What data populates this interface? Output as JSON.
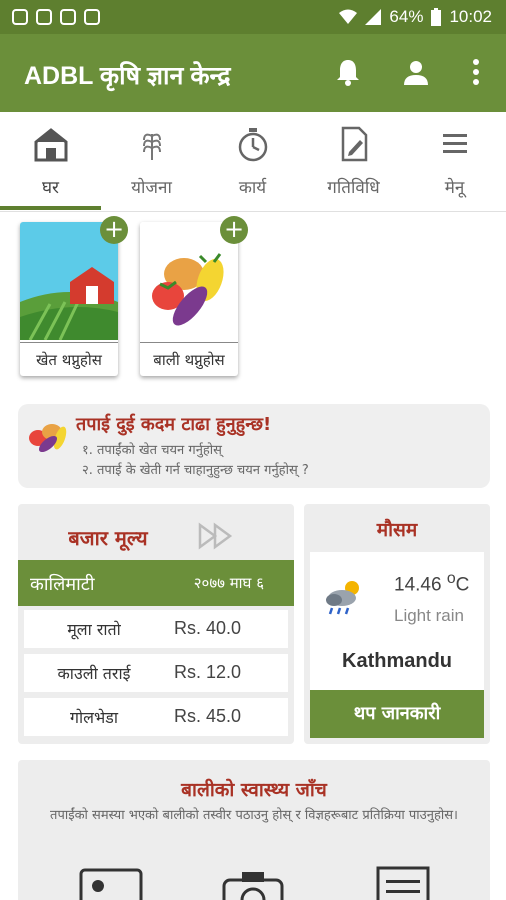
{
  "status_bar": {
    "battery": "64%",
    "time": "10:02"
  },
  "app_bar": {
    "title": "ADBL कृषि ज्ञान केन्द्र",
    "icons": [
      "bell-icon",
      "person-icon",
      "more-vert-icon"
    ]
  },
  "tabs": [
    {
      "label": "घर",
      "icon": "home-icon",
      "active": true
    },
    {
      "label": "योजना",
      "icon": "wheat-icon",
      "active": false
    },
    {
      "label": "कार्य",
      "icon": "stopwatch-icon",
      "active": false
    },
    {
      "label": "गतिविधि",
      "icon": "document-edit-icon",
      "active": false
    },
    {
      "label": "मेनू",
      "icon": "menu-icon",
      "active": false
    }
  ],
  "tiles": [
    {
      "label": "खेत थप्नुहोस",
      "icon": "farm-icon"
    },
    {
      "label": "बाली थप्नुहोस",
      "icon": "vegetables-icon"
    }
  ],
  "info_card": {
    "heading": "तपाई दुई कदम टाढा हुनुहुन्छ!",
    "line1": "१. तपाईंको खेत चयन गर्नुहोस्",
    "line2": "२. तपाई के खेती गर्न चाहानुहुन्छ चयन गर्नुहोस् ?"
  },
  "market": {
    "title": "बजार मूल्य",
    "place": "कालिमाटी",
    "date": "२०७७ माघ ६",
    "rows": [
      {
        "name": "मूला रातो",
        "price": "Rs. 40.0"
      },
      {
        "name": "काउली तराई",
        "price": "Rs. 12.0"
      },
      {
        "name": "गोलभेडा",
        "price": "Rs. 45.0"
      }
    ]
  },
  "weather": {
    "title": "मौसम",
    "temp_value": "14.46",
    "temp_unit_sup": "o",
    "temp_unit": "C",
    "description": "Light rain",
    "city": "Kathmandu",
    "more_button": "थप जानकारी"
  },
  "health": {
    "title": "बालीको स्वास्थ्य जाँच",
    "description": "तपाईंको समस्या भएको बालीको तस्वीर पठाउनु होस् र विज्ञहरूबाट प्रतिक्रिया पाउनुहोस।",
    "icons": [
      "gallery-icon",
      "camera-icon",
      "list-document-icon"
    ]
  },
  "colors": {
    "primary": "#6b8f3a",
    "status_bar": "#5e7f2f",
    "accent_text": "#a93225"
  }
}
